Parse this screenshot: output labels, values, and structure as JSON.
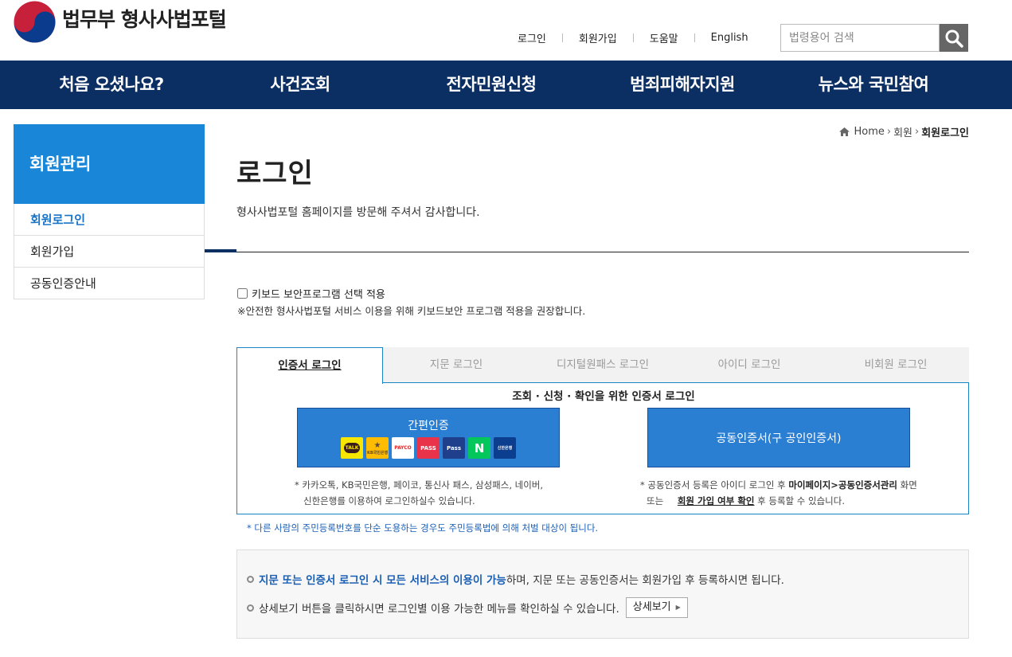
{
  "header": {
    "logo_text": "법무부 형사사법포털",
    "util_links": [
      "로그인",
      "회원가입",
      "도움말",
      "English"
    ],
    "search": {
      "placeholder": "법령용어 검색",
      "button_icon": "search-icon"
    }
  },
  "gnb": {
    "items": [
      "처음 오셨나요?",
      "사건조회",
      "전자민원신청",
      "범죄피해자지원",
      "뉴스와 국민참여"
    ]
  },
  "sidebar": {
    "title": "회원관리",
    "items": [
      {
        "label": "회원로그인",
        "active": true
      },
      {
        "label": "회원가입",
        "active": false
      },
      {
        "label": "공동인증안내",
        "active": false
      }
    ]
  },
  "breadcrumb": {
    "home": "Home",
    "level1": "회원",
    "current": "회원로그인",
    "home_icon": "home-icon"
  },
  "page": {
    "title": "로그인",
    "subtitle": "형사사법포털 홈페이지를 방문해 주셔서 감사합니다."
  },
  "keyboard": {
    "checkbox_label": "키보드 보안프로그램 선택 적용",
    "checked": false,
    "note": "※안전한 형사사법포털 서비스 이용을 위해 키보드보안 프로그램 적용을 권장합니다."
  },
  "tabs": [
    "인증서 로그인",
    "지문 로그인",
    "디지털원패스 로그인",
    "아이디 로그인",
    "비회원 로그인"
  ],
  "active_tab": 0,
  "cert_panel": {
    "title": "조회 · 신청 · 확인을 위한 인증서 로그인",
    "simple_auth": {
      "label": "간편인증",
      "providers": [
        {
          "name": "TALK",
          "icon": "kakaotalk-icon",
          "color": "#f7e600"
        },
        {
          "name": "KB국민은행",
          "icon": "kb-bank-icon",
          "color": "#ffbc00"
        },
        {
          "name": "PAYCO",
          "icon": "payco-icon",
          "color": "#fff"
        },
        {
          "name": "PASS",
          "icon": "pass-icon",
          "color": "#e8334a"
        },
        {
          "name": "Pass",
          "icon": "samsung-pass-icon",
          "color": "#1f3f8c"
        },
        {
          "name": "N",
          "icon": "naver-icon",
          "color": "#03c75a"
        },
        {
          "name": "신한은행",
          "icon": "shinhan-icon",
          "color": "#0b3e8e"
        }
      ],
      "note_line1": "* 카카오톡, KB국민은행, 페이코, 통신사 패스, 삼성패스, 네이버,",
      "note_line2": "신한은행를 이용하여 로그인하실수 있습니다."
    },
    "joint_cert": {
      "label": "공동인증서(구 공인인증서)",
      "note_a": "* 공동인증서 등록은 아이디 로그인 후",
      "note_b": "마이페이지>공동인증서관리",
      "note_c": "화면",
      "note_d": "또는",
      "note_e": "회원 가입 여부 확인",
      "note_f": "후 등록할 수 있습니다."
    }
  },
  "warning": "* 다른 사람의 주민등록번호를 단순 도용하는 경우도 주민등록법에 의해 처벌 대상이 됩니다.",
  "info": {
    "row1_highlight": "지문 또는 인증서 로그인 시 모든 서비스의 이용이 가능",
    "row1_rest": "하며, 지문 또는 공동인증서는 회원가입 후 등록하시면 됩니다.",
    "row2_text": "상세보기 버튼을 클릭하시면 로그인별 이용 가능한 메뉴를 확인하실 수 있습니다.",
    "detail_button": "상세보기"
  }
}
